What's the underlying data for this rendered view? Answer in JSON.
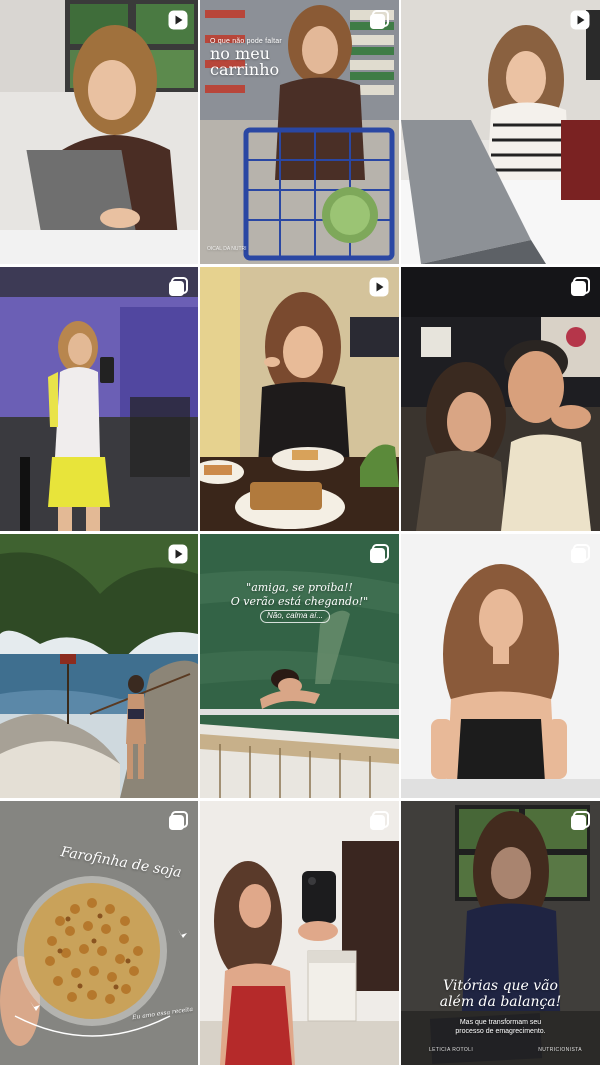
{
  "grid": {
    "tiles": [
      {
        "badge": "play-reel-icon",
        "scene": "woman-laptop-office"
      },
      {
        "badge": "carousel-icon",
        "scene": "woman-shopping-cart",
        "text": {
          "small": "O que não pode faltar",
          "big_line1": "no meu",
          "big_line2": "carrinho",
          "corner": "OICAL DA NUTRI"
        }
      },
      {
        "badge": "play-reel-icon",
        "scene": "woman-laptop-desk"
      },
      {
        "badge": "carousel-icon",
        "scene": "gym-mirror-selfie"
      },
      {
        "badge": "play-reel-icon",
        "scene": "woman-eating-meal"
      },
      {
        "badge": "carousel-icon",
        "scene": "couple-selfie"
      },
      {
        "badge": "play-reel-icon",
        "scene": "trail-by-sea"
      },
      {
        "badge": "carousel-icon",
        "scene": "woman-swimming-boat",
        "text": {
          "line1": "\"amiga, se proiba!!",
          "line2": "O verão está chegando!\"",
          "pill": "Não, calma aí..."
        }
      },
      {
        "badge": "carousel-icon",
        "scene": "woman-portrait-studio"
      },
      {
        "badge": "carousel-icon",
        "scene": "farofinha-bowl",
        "text": {
          "title": "Farofinha de soja",
          "note": "Eu amo essa receita"
        }
      },
      {
        "badge": "carousel-icon",
        "scene": "mirror-phone-selfie"
      },
      {
        "badge": "carousel-icon",
        "scene": "woman-at-desk",
        "text": {
          "title_line1": "Vitórias que vão",
          "title_line2": "além da balança!",
          "sub_line1": "Mas que transformam seu",
          "sub_line2": "processo de emagrecimento.",
          "left": "LETICIA ROTOLI",
          "right": "NUTRICIONISTA"
        }
      }
    ]
  },
  "colors": {
    "badge": "#ffffff"
  }
}
